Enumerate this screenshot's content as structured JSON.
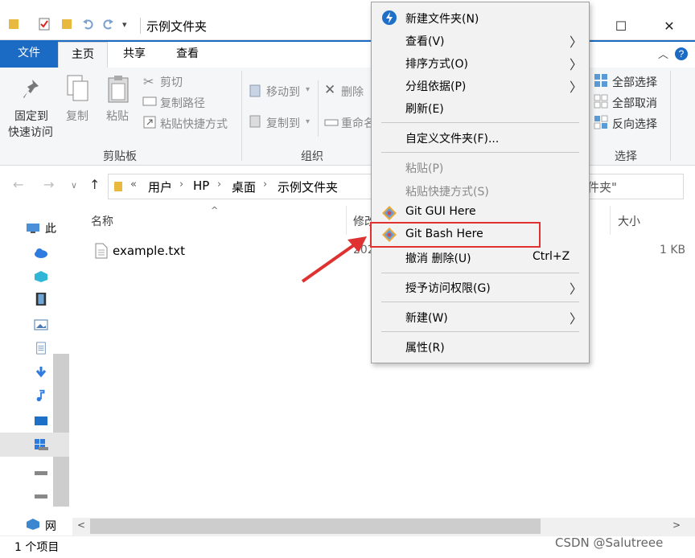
{
  "window": {
    "title": "示例文件夹",
    "minimize": "—",
    "maximize": "☐",
    "close": "✕"
  },
  "ribbon_tabs": {
    "file": "文件",
    "home": "主页",
    "share": "共享",
    "view": "查看"
  },
  "ribbon": {
    "pin_label_1": "固定到",
    "pin_label_2": "快速访问",
    "copy": "复制",
    "paste": "粘贴",
    "cut": "剪切",
    "copy_path": "复制路径",
    "paste_shortcut": "粘贴快捷方式",
    "clipboard_group": "剪贴板",
    "move_to": "移动到",
    "copy_to": "复制到",
    "delete": "删除",
    "rename": "重命名",
    "organize_group": "组织",
    "select_all": "全部选择",
    "select_none": "全部取消",
    "invert_selection": "反向选择",
    "select_group": "选择"
  },
  "address": {
    "crumbs": [
      "«",
      "用户",
      "HP",
      "桌面",
      "示例文件夹"
    ],
    "search_text": "件夹\""
  },
  "nav_pane": {
    "this_pc_label": "此",
    "network_label": "网"
  },
  "file_list": {
    "col_name": "名称",
    "col_modified": "修改",
    "col_size": "大小",
    "rows": [
      {
        "name": "example.txt",
        "modified": "202",
        "size": "1 KB"
      }
    ]
  },
  "status": {
    "count": "1 个项目"
  },
  "context_menu": {
    "items": [
      {
        "label": "新建文件夹(N)"
      },
      {
        "label": "查看(V)"
      },
      {
        "label": "排序方式(O)"
      },
      {
        "label": "分组依据(P)"
      },
      {
        "label": "刷新(E)"
      },
      {
        "label": "自定义文件夹(F)..."
      },
      {
        "label": "粘贴(P)"
      },
      {
        "label": "粘贴快捷方式(S)"
      },
      {
        "label": "Git GUI Here"
      },
      {
        "label": "Git Bash Here"
      },
      {
        "label": "撤消 删除(U)",
        "shortcut": "Ctrl+Z"
      },
      {
        "label": "授予访问权限(G)"
      },
      {
        "label": "新建(W)"
      },
      {
        "label": "属性(R)"
      }
    ]
  },
  "watermark": "CSDN @Salutreee",
  "colors": {
    "ribbon_blue": "#1b6bc4",
    "highlight_red": "#e03131"
  }
}
